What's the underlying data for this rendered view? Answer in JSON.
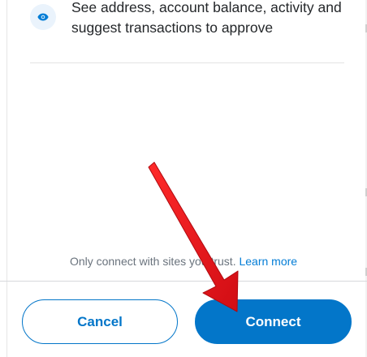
{
  "permission": {
    "icon": "eye-icon",
    "text": "See address, account balance, activity and suggest transactions to approve"
  },
  "footer": {
    "trust_note": "Only connect with sites you trust.",
    "learn_more": "Learn more"
  },
  "actions": {
    "cancel_label": "Cancel",
    "connect_label": "Connect"
  },
  "colors": {
    "primary": "#0376c9",
    "icon_bg": "#eaf3fc",
    "annotation_arrow": "#e8141b"
  }
}
